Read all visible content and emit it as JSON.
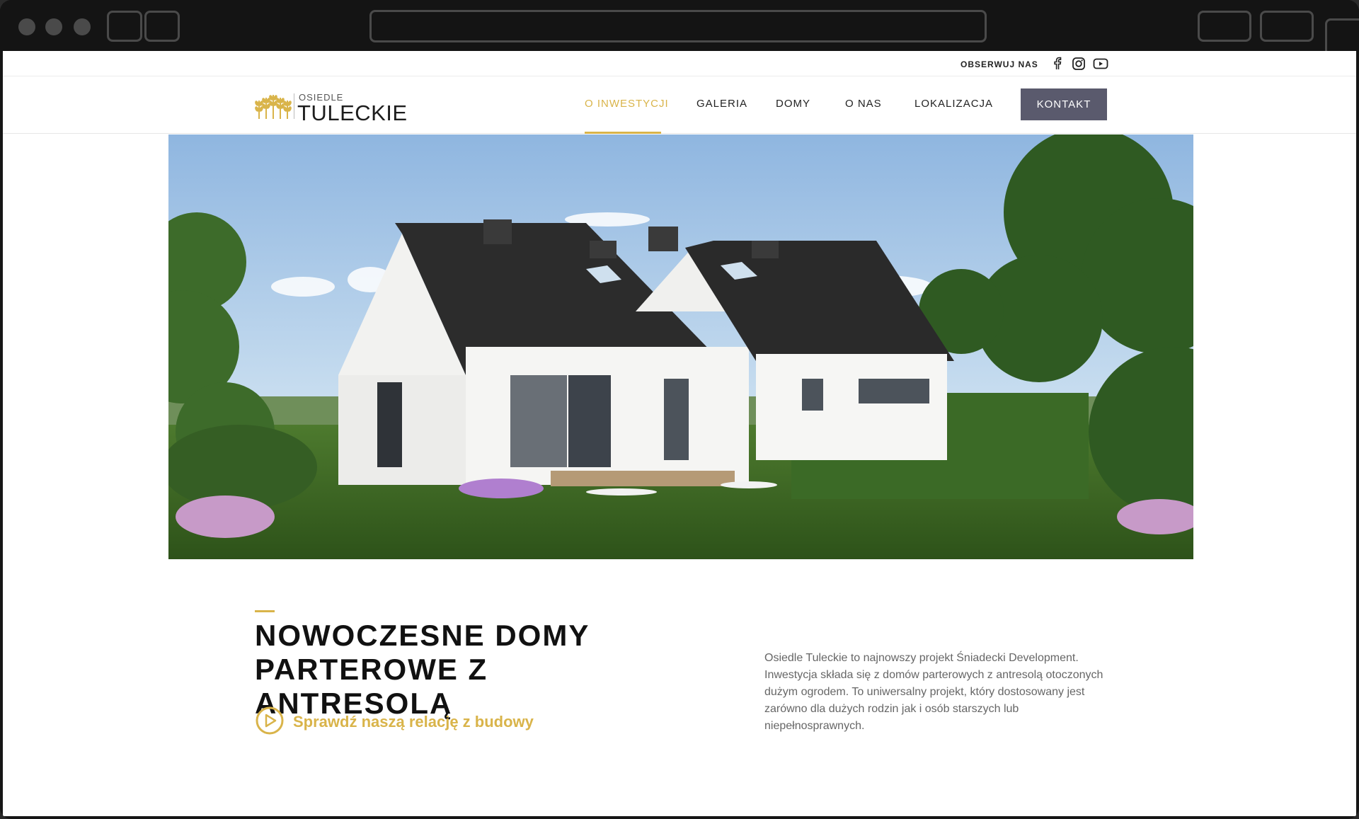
{
  "topbar": {
    "follow_label": "OBSERWUJ NAS"
  },
  "logo": {
    "line1": "OSIEDLE",
    "line2": "TULECKIE"
  },
  "nav": {
    "items": [
      {
        "label": "O INWESTYCJI",
        "active": true
      },
      {
        "label": "GALERIA",
        "active": false
      },
      {
        "label": "DOMY",
        "active": false
      },
      {
        "label": "O NAS",
        "active": false
      },
      {
        "label": "LOKALIZACJA",
        "active": false
      }
    ],
    "cta_label": "KONTAKT"
  },
  "content": {
    "headline_line1": "NOWOCZESNE DOMY",
    "headline_line2": "PARTEROWE Z ANTRESOLĄ",
    "video_link": "Sprawdź naszą relację z budowy",
    "description": "Osiedle Tuleckie to najnowszy projekt Śniadecki Development. Inwestycja składa się z domów parterowych z antresolą otoczonych dużym ogrodem. To uniwersalny projekt, który dostosowany jest zarówno dla dużych rodzin jak i osób starszych lub niepełnosprawnych."
  },
  "colors": {
    "accent": "#d9b44a",
    "cta": "#5a5a6d",
    "chrome": "#141414"
  }
}
